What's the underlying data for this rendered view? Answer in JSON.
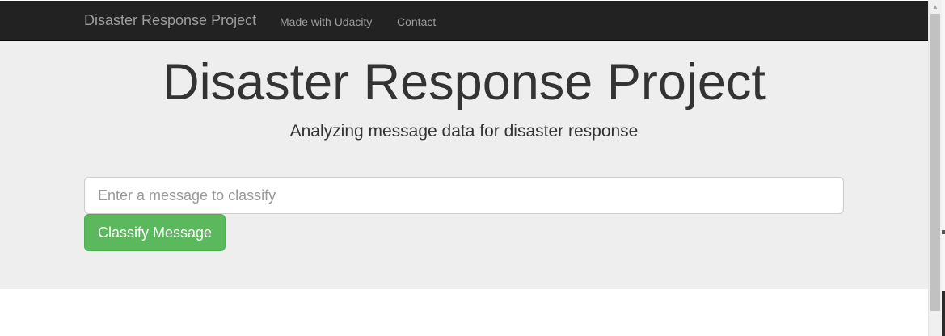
{
  "navbar": {
    "brand": "Disaster Response Project",
    "links": [
      {
        "label": "Made with Udacity"
      },
      {
        "label": "Contact"
      }
    ]
  },
  "jumbotron": {
    "title": "Disaster Response Project",
    "subtitle": "Analyzing message data for disaster response"
  },
  "form": {
    "message_value": "",
    "message_placeholder": "Enter a message to classify",
    "submit_label": "Classify Message"
  },
  "colors": {
    "navbar_bg": "#222222",
    "nav_text": "#9d9d9d",
    "jumbotron_bg": "#eeeeee",
    "button_bg": "#5cb85c",
    "button_border": "#4cae4c"
  },
  "scrollbar": {
    "up_arrow_icon": "chevron-up-icon"
  }
}
